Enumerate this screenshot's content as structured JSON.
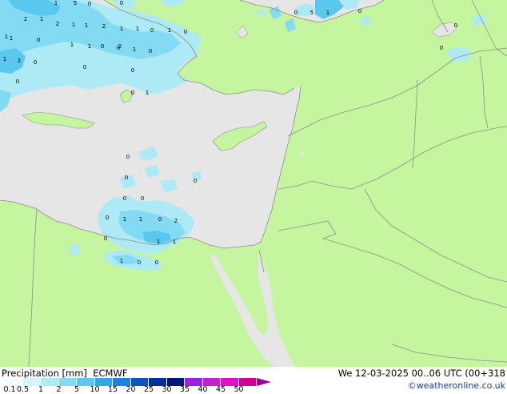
{
  "header": {
    "legend_title": "Precipitation [mm]",
    "model": "ECMWF",
    "valid_time": "We 12-03-2025 00..06 UTC (00+318",
    "credit": "©weatheronline.co.uk"
  },
  "legend": {
    "ticks": [
      "0.1",
      "0.5",
      "1",
      "2",
      "5",
      "10",
      "15",
      "20",
      "25",
      "30",
      "35",
      "40",
      "45",
      "50"
    ],
    "colors": [
      "#f2fbfe",
      "#d6f4fb",
      "#aee9f6",
      "#82dbf2",
      "#5ac8ee",
      "#31a8e8",
      "#1e80e0",
      "#1352c4",
      "#0b2ca0",
      "#06157a",
      "#9b20e8",
      "#c81ed8",
      "#e00fc8",
      "#d20094"
    ],
    "overflow_color": "#9b0090"
  },
  "map": {
    "land_color": "#c6f5a0",
    "sea_color": "#e6e6e6",
    "border_color": "#8c8c8c",
    "precip_values": [
      {
        "label": "2",
        "c": "black"
      },
      {
        "label": "1",
        "c": "black"
      },
      {
        "label": "1",
        "c": "black"
      },
      {
        "label": "5",
        "c": "black"
      },
      {
        "label": "0",
        "c": "black"
      },
      {
        "label": "1",
        "c": "black"
      },
      {
        "label": "2",
        "c": "black"
      },
      {
        "label": "1",
        "c": "black"
      },
      {
        "label": "1",
        "c": "black"
      },
      {
        "label": "2",
        "c": "black"
      },
      {
        "label": "1",
        "c": "black"
      },
      {
        "label": "1",
        "c": "black"
      },
      {
        "label": "0",
        "c": "black"
      },
      {
        "label": "1",
        "c": "black"
      },
      {
        "label": "0",
        "c": "black"
      },
      {
        "label": "1",
        "c": "black"
      },
      {
        "label": "0",
        "c": "black"
      },
      {
        "label": "1",
        "c": "black"
      },
      {
        "label": "0",
        "c": "black"
      },
      {
        "label": "1",
        "c": "black"
      },
      {
        "label": "1",
        "c": "black"
      },
      {
        "label": "0",
        "c": "black"
      },
      {
        "label": "2",
        "c": "black"
      },
      {
        "label": "0",
        "c": "black"
      },
      {
        "label": "0",
        "c": "black"
      },
      {
        "label": "1",
        "c": "black"
      },
      {
        "label": "2",
        "c": "black"
      },
      {
        "label": "0",
        "c": "black"
      },
      {
        "label": "0",
        "c": "black"
      },
      {
        "label": "0",
        "c": "black"
      },
      {
        "label": "0",
        "c": "black"
      },
      {
        "label": "0",
        "c": "black"
      },
      {
        "label": "1",
        "c": "black"
      },
      {
        "label": "0",
        "c": "black"
      },
      {
        "label": "5",
        "c": "black"
      },
      {
        "label": "1",
        "c": "black"
      },
      {
        "label": "0",
        "c": "black"
      },
      {
        "label": "0",
        "c": "black"
      },
      {
        "label": "0",
        "c": "black"
      },
      {
        "label": "0",
        "c": "black"
      },
      {
        "label": "0",
        "c": "black"
      },
      {
        "label": "0",
        "c": "black"
      },
      {
        "label": "0",
        "c": "black"
      },
      {
        "label": "0",
        "c": "black"
      },
      {
        "label": "1",
        "c": "black"
      },
      {
        "label": "1",
        "c": "black"
      },
      {
        "label": "0",
        "c": "black"
      },
      {
        "label": "2",
        "c": "black"
      },
      {
        "label": "0",
        "c": "black"
      },
      {
        "label": "1",
        "c": "black"
      },
      {
        "label": "1",
        "c": "black"
      },
      {
        "label": "0",
        "c": "black"
      },
      {
        "label": "1",
        "c": "black"
      },
      {
        "label": "0",
        "c": "black"
      },
      {
        "label": "0",
        "c": "black"
      }
    ]
  }
}
